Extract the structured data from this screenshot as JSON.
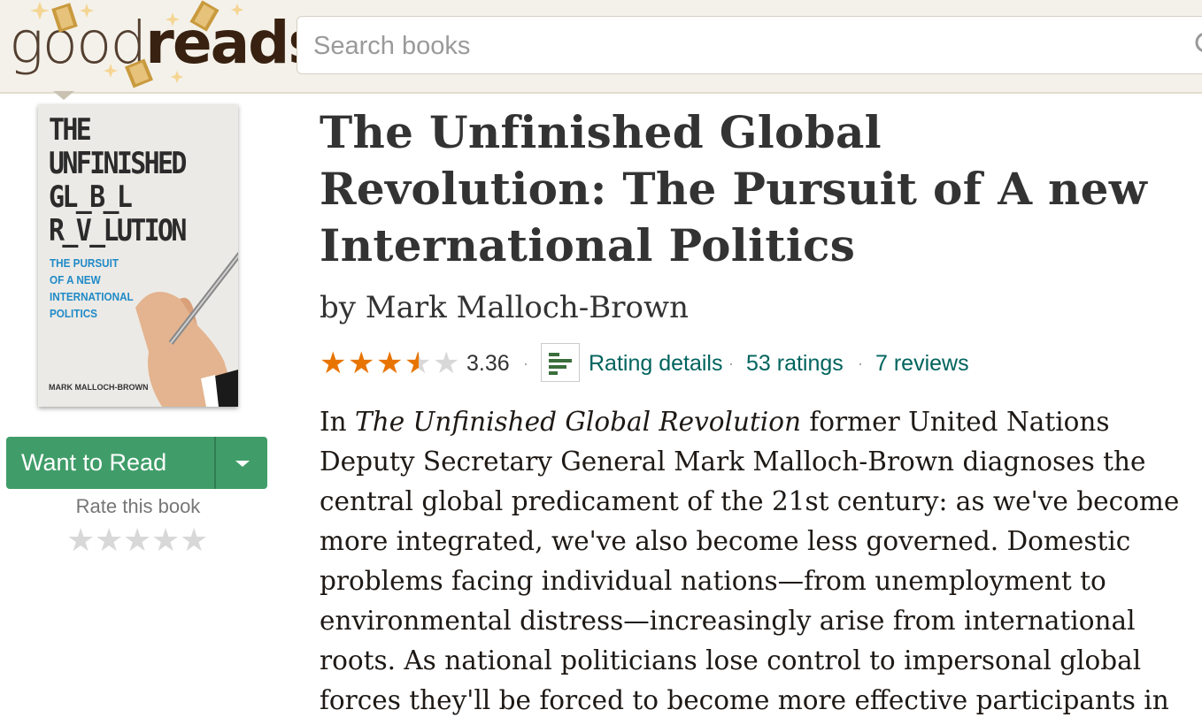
{
  "header": {
    "logo_good": "good",
    "logo_reads": "reads",
    "search_placeholder": "Search books"
  },
  "book": {
    "cover": {
      "title_lines": [
        "THE",
        "UNFINISHED",
        "GL_B_L",
        "R_V_LUTION"
      ],
      "subtitle_lines": [
        "THE PURSUIT",
        "OF A NEW",
        "INTERNATIONAL",
        "POLITICS"
      ],
      "author": "MARK MALLOCH-BROWN"
    },
    "title": "The Unfinished Global Revolution: The Pursuit of A new International Politics",
    "by_label": "by",
    "author": "Mark Malloch-Brown",
    "rating": 3.36,
    "rating_text": "3.36",
    "rating_details_label": "Rating details",
    "ratings_count": "53 ratings",
    "reviews_count": "7 reviews",
    "description_italic": "The Unfinished Global Revolution",
    "description_prefix": "In ",
    "description_rest": " former United Nations Deputy Secretary General Mark Malloch-Brown diagnoses the central global predicament of the 21st century: as we've become more integrated, we've also become less governed. Domestic problems facing individual nations—from unemployment to environmental distress—increasingly arise from international roots. As national politicians lose control to impersonal global forces they'll be forced to become more effective participants in"
  },
  "shelf": {
    "want_to_read_label": "Want to Read",
    "rate_label": "Rate this book"
  },
  "colors": {
    "header_bg": "#f4f1ea",
    "brand_brown": "#382110",
    "button_green": "#409d69",
    "star_orange": "#e87400",
    "link_teal": "#00635d"
  }
}
